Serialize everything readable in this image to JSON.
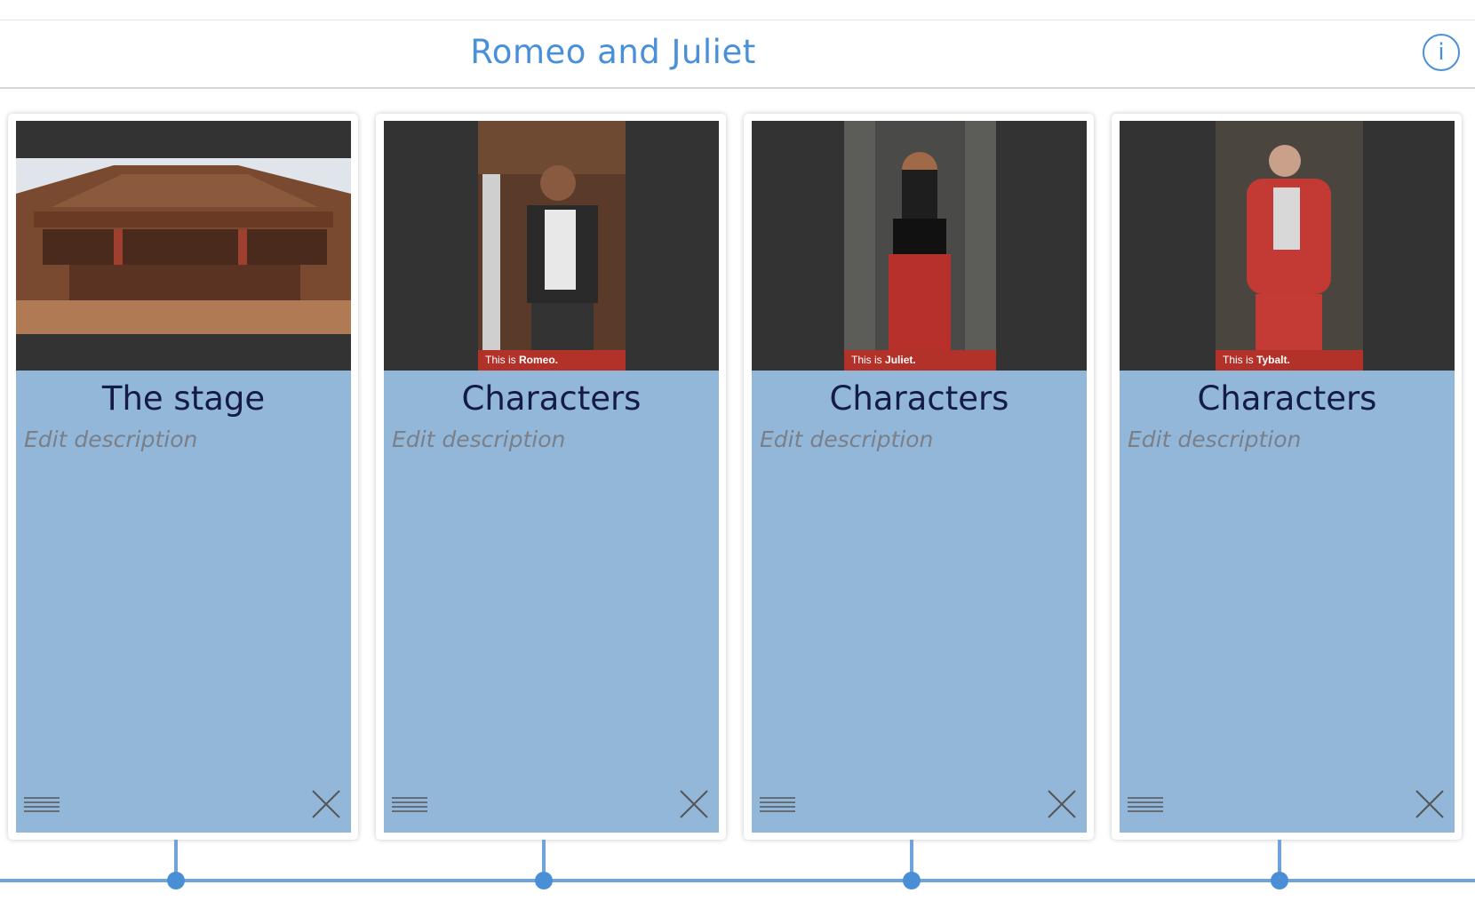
{
  "header": {
    "title": "Romeo and Juliet",
    "info_label": "i"
  },
  "cards": [
    {
      "title": "The stage",
      "description": "Edit description"
    },
    {
      "title": "Characters",
      "description": "Edit description",
      "caption_prefix": "This is ",
      "caption_name": "Romeo."
    },
    {
      "title": "Characters",
      "description": "Edit description",
      "caption_prefix": "This is ",
      "caption_name": "Juliet."
    },
    {
      "title": "Characters",
      "description": "Edit description",
      "caption_prefix": "This is ",
      "caption_name": "Tybalt."
    }
  ],
  "colors": {
    "accent": "#4a90d9",
    "card_body": "#93b7d9",
    "image_bg": "#333333",
    "caption_bg": "#b2322a"
  }
}
